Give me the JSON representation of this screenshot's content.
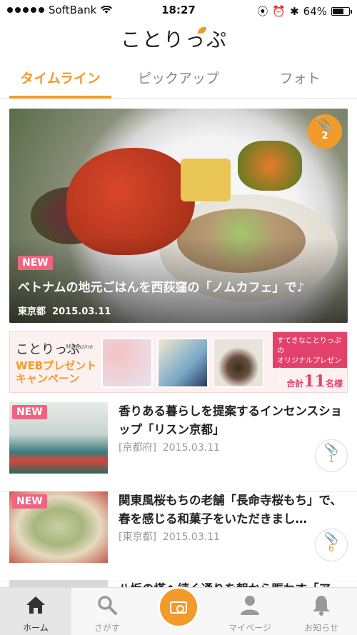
{
  "status_bar": {
    "carrier": "SoftBank",
    "time": "18:27",
    "battery": "64%"
  },
  "app": {
    "logo_text": "ことりっぷ"
  },
  "tabs": [
    {
      "label": "タイムライン",
      "active": true
    },
    {
      "label": "ピックアップ",
      "active": false
    },
    {
      "label": "フォト",
      "active": false
    }
  ],
  "hero": {
    "badge": "NEW",
    "title": "ベトナムの地元ごはんを西荻窪の「ノムカフェ」で♪",
    "location": "東京都",
    "date": "2015.03.11",
    "clip_count": "2"
  },
  "banner": {
    "logo": "ことりっぷ",
    "magazine": "Magazine",
    "web_line1": "WEBプレゼント",
    "web_line2": "キャンペーン",
    "promo_line1": "すてきなことりっぷの",
    "promo_line2": "オリジナルプレゼント",
    "promo_line3": "が当たる",
    "total_prefix": "合計",
    "total_number": "11",
    "total_suffix": "名様"
  },
  "articles": [
    {
      "badge": "NEW",
      "title": "香りある暮らしを提案するインセンスショップ「リスン京都」",
      "location": "[京都府]",
      "date": "2015.03.11",
      "clip_count": "1"
    },
    {
      "badge": "NEW",
      "title": "関東風桜もちの老舗「長命寺桜もち」で、春を感じる和菓子をいただきまし…",
      "location": "[東京都]",
      "date": "2015.03.11",
      "clip_count": "6"
    },
    {
      "title": "八坂の塔へ続く通りを朝から賑わす「ア"
    }
  ],
  "tabbar": [
    {
      "label": "ホーム",
      "icon": "home-icon",
      "active": true
    },
    {
      "label": "さがす",
      "icon": "search-icon"
    },
    {
      "label": "",
      "icon": "camera-icon"
    },
    {
      "label": "マイページ",
      "icon": "person-icon"
    },
    {
      "label": "お知らせ",
      "icon": "bell-icon"
    }
  ],
  "colors": {
    "accent": "#f29b2b",
    "new_badge": "#f06482",
    "promo": "#e3416b"
  }
}
